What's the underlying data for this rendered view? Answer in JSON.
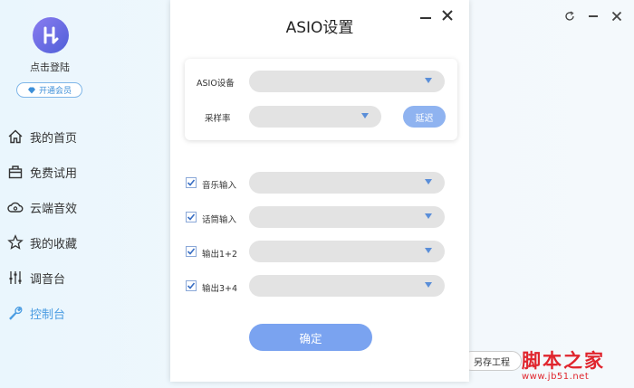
{
  "user": {
    "login_text": "点击登陆",
    "vip_label": "开通会员"
  },
  "nav": {
    "items": [
      {
        "label": "我的首页",
        "icon": "home-icon"
      },
      {
        "label": "免费试用",
        "icon": "gift-icon"
      },
      {
        "label": "云端音效",
        "icon": "cloud-icon"
      },
      {
        "label": "我的收藏",
        "icon": "star-icon"
      },
      {
        "label": "调音台",
        "icon": "mixer-icon"
      },
      {
        "label": "控制台",
        "icon": "wrench-icon"
      }
    ],
    "active_index": 5
  },
  "footer": {
    "save_project_label": "另存工程"
  },
  "watermark": {
    "text": "脚本之家",
    "url": "www.jb51.net"
  },
  "dialog": {
    "title": "ASIO设置",
    "device_section": {
      "asio_device_label": "ASIO设备",
      "asio_device_value": "",
      "sample_rate_label": "采样率",
      "sample_rate_value": "",
      "delay_button_label": "延迟"
    },
    "channels": [
      {
        "label": "音乐输入",
        "checked": true,
        "value": ""
      },
      {
        "label": "话筒输入",
        "checked": true,
        "value": ""
      },
      {
        "label": "输出1+2",
        "checked": true,
        "value": ""
      },
      {
        "label": "输出3+4",
        "checked": true,
        "value": ""
      }
    ],
    "confirm_label": "确定"
  },
  "colors": {
    "accent": "#4a9ce2",
    "button": "#7aa3f0",
    "caret": "#5a8ed8",
    "watermark": "#e0252d"
  }
}
